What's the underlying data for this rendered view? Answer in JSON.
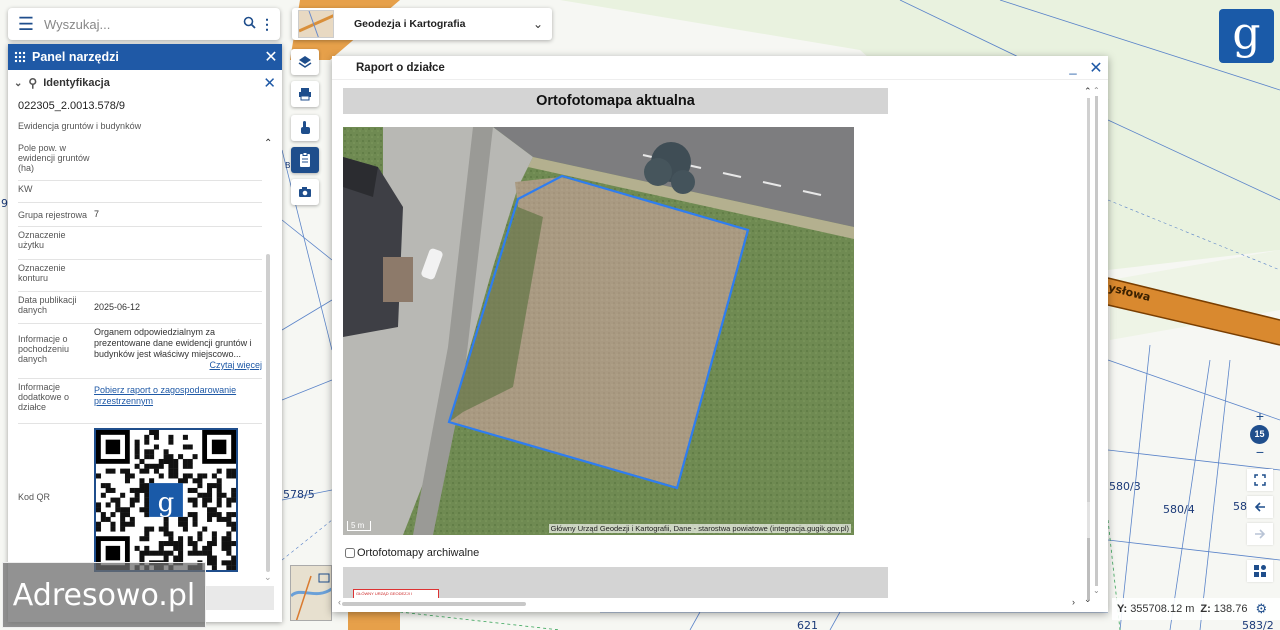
{
  "search": {
    "placeholder": "Wyszukaj..."
  },
  "layer_selector": {
    "name": "Geodezja i Kartografia"
  },
  "panel": {
    "title": "Panel narzędzi",
    "section_title": "Identyfikacja",
    "parcel_id": "022305_2.0013.578/9",
    "source": "Ewidencja gruntów i budynków",
    "rows": [
      {
        "key": "Pole pow. w ewidencji gruntów (ha)",
        "value": ""
      },
      {
        "key": "KW",
        "value": ""
      },
      {
        "key": "Grupa rejestrowa",
        "value": "7"
      },
      {
        "key": "Oznaczenie użytku",
        "value": ""
      },
      {
        "key": "Oznaczenie konturu",
        "value": ""
      },
      {
        "key": "Data publikacji danych",
        "value": "2025-06-12"
      },
      {
        "key": "Informacje o pochodzeniu danych",
        "value": "Organem odpowiedzialnym za prezentowane dane ewidencji gruntów i budynków jest właściwy miejscowo...",
        "link": "Czytaj więcej"
      },
      {
        "key": "Informacje dodatkowe o działce",
        "link": "Pobierz raport o zagospodarowanie przestrzennym"
      },
      {
        "key": "Kod QR",
        "value": ""
      }
    ]
  },
  "watermark": "Adresowo.pl",
  "report": {
    "title": "Raport o działce",
    "section_title": "Ortofotomapa aktualna",
    "attribution": "Główny Urząd Geodezji i Kartografii, Dane - starostwa powiatowe (integracja.gugik.gov.pl)",
    "scale": "5 m",
    "archive_label": "Ortofotomapy archiwalne",
    "next_stamp": "GŁÓWNY URZĄD GEODEZJI I KARTOGRAFII"
  },
  "map": {
    "street_label": "ysłowa",
    "parcel_labels": [
      "578/5",
      "580/3",
      "580/4",
      "58",
      "621",
      "583/2",
      "9",
      "B"
    ]
  },
  "controls": {
    "zoom_in": "+",
    "zoom_level": "15",
    "zoom_out": "−"
  },
  "coords": {
    "y_label": "Y:",
    "y_value": "355708.12 m",
    "z_label": "Z:",
    "z_value": "138.76"
  },
  "colors": {
    "brand": "#1f59a6",
    "parcel_outline": "#2f7df0"
  }
}
